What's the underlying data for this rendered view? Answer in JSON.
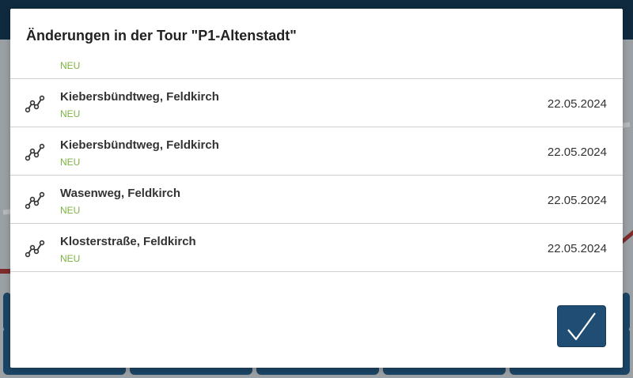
{
  "dialog": {
    "title": "Änderungen in der Tour \"P1-Altenstadt\"",
    "confirm_icon": "checkmark-icon"
  },
  "rows": [
    {
      "street": "",
      "status": "NEU",
      "date": "",
      "icon": "route-icon"
    },
    {
      "street": "Kiebersbündtweg, Feldkirch",
      "status": "NEU",
      "date": "22.05.2024",
      "icon": "route-icon"
    },
    {
      "street": "Kiebersbündtweg, Feldkirch",
      "status": "NEU",
      "date": "22.05.2024",
      "icon": "route-icon"
    },
    {
      "street": "Wasenweg, Feldkirch",
      "status": "NEU",
      "date": "22.05.2024",
      "icon": "route-icon"
    },
    {
      "street": "Klosterstraße, Feldkirch",
      "status": "NEU",
      "date": "22.05.2024",
      "icon": "route-icon"
    },
    {
      "street": "",
      "status": "",
      "date": "",
      "icon": ""
    }
  ],
  "colors": {
    "status_new": "#7cb342",
    "confirm_button": "#1f4d74",
    "header_bar": "#0f2a3f"
  }
}
